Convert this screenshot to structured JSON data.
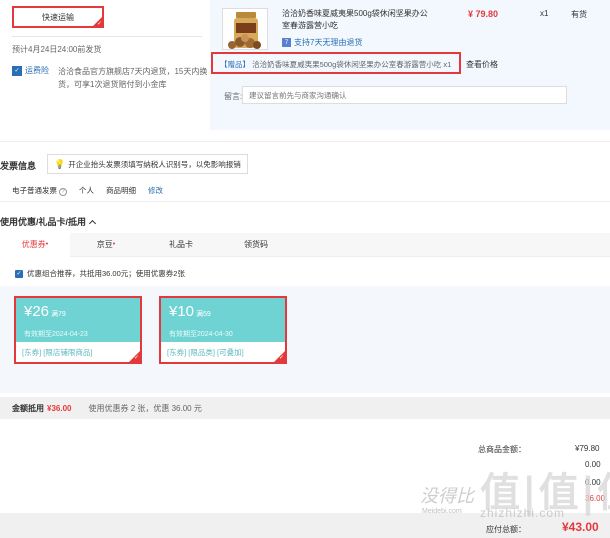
{
  "shipping": {
    "method_label": "快速运输",
    "estimate": "预计4月24日24:00前发货",
    "service_badge": "运费险",
    "service_text": "洽洽食品官方旗舰店7天内退货，15天内换货，可享1次退货赔付到小金库"
  },
  "product": {
    "title": "洽洽奶香味夏威夷果500g袋休闲坚果办公室春游露营小吃",
    "price": "¥ 79.80",
    "qty": "x1",
    "stock": "有货",
    "return_icon": "7",
    "return_policy": "支持7天无理由退货",
    "gift_tag": "【赠品】",
    "gift_text": "洽洽奶香味夏威夷果500g袋休闲坚果办公室春游露营小吃 x1",
    "gift_link": "查看价格",
    "message_label": "留言:",
    "message_placeholder": "建议留言前先与商家沟通确认"
  },
  "invoice": {
    "title": "发票信息",
    "tip": "开企业抬头发票须填写纳税人识别号，以免影响报销",
    "type": "电子普通发票",
    "help": "?",
    "header": "个人",
    "content": "商品明细",
    "edit_label": "修改"
  },
  "coupons": {
    "title": "使用优惠/礼品卡/抵用",
    "tabs": [
      {
        "label": "优惠券",
        "dot": "•"
      },
      {
        "label": "京豆",
        "dot": "•"
      },
      {
        "label": "礼品卡",
        "dot": ""
      },
      {
        "label": "领货码",
        "dot": ""
      }
    ],
    "checkbox_text": "优惠组合推荐，共抵用36.00元；使用优惠券2张",
    "items": [
      {
        "amount": "¥26",
        "min": "满79",
        "expiry": "有效期至2024-04-23",
        "tags": "[东券] [限店铺限商品]"
      },
      {
        "amount": "¥10",
        "min": "满59",
        "expiry": "有效期至2024-04-30",
        "tags": "[东券] [限品类] [可叠加]"
      }
    ],
    "summary_label": "金额抵用",
    "summary_amount": "¥36.00",
    "summary_desc": "使用优惠券 2 张，优惠 36.00 元"
  },
  "totals": {
    "goods_label": "总商品金额：",
    "goods_value": "¥79.80",
    "row2_value": "0.00",
    "row3_value": "0.00",
    "row4_value": "36.00",
    "pay_label": "应付总额：",
    "pay_value": "¥43.00"
  },
  "watermark": {
    "line1": "没得比",
    "big": "值|值|值",
    "site": "Meidebi.com",
    "url": "zhizhizhi.com"
  },
  "colors": {
    "accent_red": "#e4393c",
    "link_blue": "#2a6fb5",
    "coupon_teal": "#6fd3d3"
  }
}
